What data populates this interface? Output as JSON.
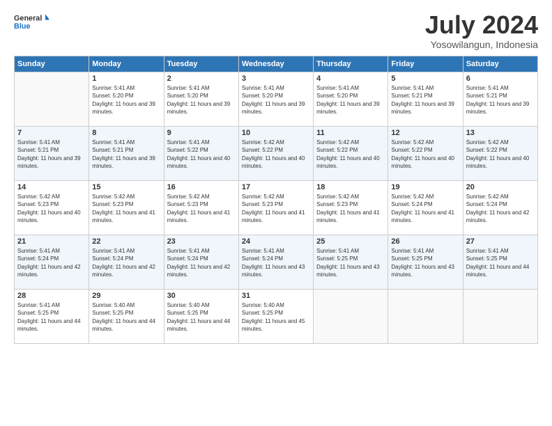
{
  "header": {
    "logo_general": "General",
    "logo_blue": "Blue",
    "month_title": "July 2024",
    "subtitle": "Yosowilangun, Indonesia"
  },
  "days_of_week": [
    "Sunday",
    "Monday",
    "Tuesday",
    "Wednesday",
    "Thursday",
    "Friday",
    "Saturday"
  ],
  "weeks": [
    [
      {
        "day": "",
        "sunrise": "",
        "sunset": "",
        "daylight": ""
      },
      {
        "day": "1",
        "sunrise": "Sunrise: 5:41 AM",
        "sunset": "Sunset: 5:20 PM",
        "daylight": "Daylight: 11 hours and 39 minutes."
      },
      {
        "day": "2",
        "sunrise": "Sunrise: 5:41 AM",
        "sunset": "Sunset: 5:20 PM",
        "daylight": "Daylight: 11 hours and 39 minutes."
      },
      {
        "day": "3",
        "sunrise": "Sunrise: 5:41 AM",
        "sunset": "Sunset: 5:20 PM",
        "daylight": "Daylight: 11 hours and 39 minutes."
      },
      {
        "day": "4",
        "sunrise": "Sunrise: 5:41 AM",
        "sunset": "Sunset: 5:20 PM",
        "daylight": "Daylight: 11 hours and 39 minutes."
      },
      {
        "day": "5",
        "sunrise": "Sunrise: 5:41 AM",
        "sunset": "Sunset: 5:21 PM",
        "daylight": "Daylight: 11 hours and 39 minutes."
      },
      {
        "day": "6",
        "sunrise": "Sunrise: 5:41 AM",
        "sunset": "Sunset: 5:21 PM",
        "daylight": "Daylight: 11 hours and 39 minutes."
      }
    ],
    [
      {
        "day": "7",
        "sunrise": "Sunrise: 5:41 AM",
        "sunset": "Sunset: 5:21 PM",
        "daylight": "Daylight: 11 hours and 39 minutes."
      },
      {
        "day": "8",
        "sunrise": "Sunrise: 5:41 AM",
        "sunset": "Sunset: 5:21 PM",
        "daylight": "Daylight: 11 hours and 39 minutes."
      },
      {
        "day": "9",
        "sunrise": "Sunrise: 5:41 AM",
        "sunset": "Sunset: 5:22 PM",
        "daylight": "Daylight: 11 hours and 40 minutes."
      },
      {
        "day": "10",
        "sunrise": "Sunrise: 5:42 AM",
        "sunset": "Sunset: 5:22 PM",
        "daylight": "Daylight: 11 hours and 40 minutes."
      },
      {
        "day": "11",
        "sunrise": "Sunrise: 5:42 AM",
        "sunset": "Sunset: 5:22 PM",
        "daylight": "Daylight: 11 hours and 40 minutes."
      },
      {
        "day": "12",
        "sunrise": "Sunrise: 5:42 AM",
        "sunset": "Sunset: 5:22 PM",
        "daylight": "Daylight: 11 hours and 40 minutes."
      },
      {
        "day": "13",
        "sunrise": "Sunrise: 5:42 AM",
        "sunset": "Sunset: 5:22 PM",
        "daylight": "Daylight: 11 hours and 40 minutes."
      }
    ],
    [
      {
        "day": "14",
        "sunrise": "Sunrise: 5:42 AM",
        "sunset": "Sunset: 5:23 PM",
        "daylight": "Daylight: 11 hours and 40 minutes."
      },
      {
        "day": "15",
        "sunrise": "Sunrise: 5:42 AM",
        "sunset": "Sunset: 5:23 PM",
        "daylight": "Daylight: 11 hours and 41 minutes."
      },
      {
        "day": "16",
        "sunrise": "Sunrise: 5:42 AM",
        "sunset": "Sunset: 5:23 PM",
        "daylight": "Daylight: 11 hours and 41 minutes."
      },
      {
        "day": "17",
        "sunrise": "Sunrise: 5:42 AM",
        "sunset": "Sunset: 5:23 PM",
        "daylight": "Daylight: 11 hours and 41 minutes."
      },
      {
        "day": "18",
        "sunrise": "Sunrise: 5:42 AM",
        "sunset": "Sunset: 5:23 PM",
        "daylight": "Daylight: 11 hours and 41 minutes."
      },
      {
        "day": "19",
        "sunrise": "Sunrise: 5:42 AM",
        "sunset": "Sunset: 5:24 PM",
        "daylight": "Daylight: 11 hours and 41 minutes."
      },
      {
        "day": "20",
        "sunrise": "Sunrise: 5:42 AM",
        "sunset": "Sunset: 5:24 PM",
        "daylight": "Daylight: 11 hours and 42 minutes."
      }
    ],
    [
      {
        "day": "21",
        "sunrise": "Sunrise: 5:41 AM",
        "sunset": "Sunset: 5:24 PM",
        "daylight": "Daylight: 11 hours and 42 minutes."
      },
      {
        "day": "22",
        "sunrise": "Sunrise: 5:41 AM",
        "sunset": "Sunset: 5:24 PM",
        "daylight": "Daylight: 11 hours and 42 minutes."
      },
      {
        "day": "23",
        "sunrise": "Sunrise: 5:41 AM",
        "sunset": "Sunset: 5:24 PM",
        "daylight": "Daylight: 11 hours and 42 minutes."
      },
      {
        "day": "24",
        "sunrise": "Sunrise: 5:41 AM",
        "sunset": "Sunset: 5:24 PM",
        "daylight": "Daylight: 11 hours and 43 minutes."
      },
      {
        "day": "25",
        "sunrise": "Sunrise: 5:41 AM",
        "sunset": "Sunset: 5:25 PM",
        "daylight": "Daylight: 11 hours and 43 minutes."
      },
      {
        "day": "26",
        "sunrise": "Sunrise: 5:41 AM",
        "sunset": "Sunset: 5:25 PM",
        "daylight": "Daylight: 11 hours and 43 minutes."
      },
      {
        "day": "27",
        "sunrise": "Sunrise: 5:41 AM",
        "sunset": "Sunset: 5:25 PM",
        "daylight": "Daylight: 11 hours and 44 minutes."
      }
    ],
    [
      {
        "day": "28",
        "sunrise": "Sunrise: 5:41 AM",
        "sunset": "Sunset: 5:25 PM",
        "daylight": "Daylight: 11 hours and 44 minutes."
      },
      {
        "day": "29",
        "sunrise": "Sunrise: 5:40 AM",
        "sunset": "Sunset: 5:25 PM",
        "daylight": "Daylight: 11 hours and 44 minutes."
      },
      {
        "day": "30",
        "sunrise": "Sunrise: 5:40 AM",
        "sunset": "Sunset: 5:25 PM",
        "daylight": "Daylight: 11 hours and 44 minutes."
      },
      {
        "day": "31",
        "sunrise": "Sunrise: 5:40 AM",
        "sunset": "Sunset: 5:25 PM",
        "daylight": "Daylight: 11 hours and 45 minutes."
      },
      {
        "day": "",
        "sunrise": "",
        "sunset": "",
        "daylight": ""
      },
      {
        "day": "",
        "sunrise": "",
        "sunset": "",
        "daylight": ""
      },
      {
        "day": "",
        "sunrise": "",
        "sunset": "",
        "daylight": ""
      }
    ]
  ]
}
